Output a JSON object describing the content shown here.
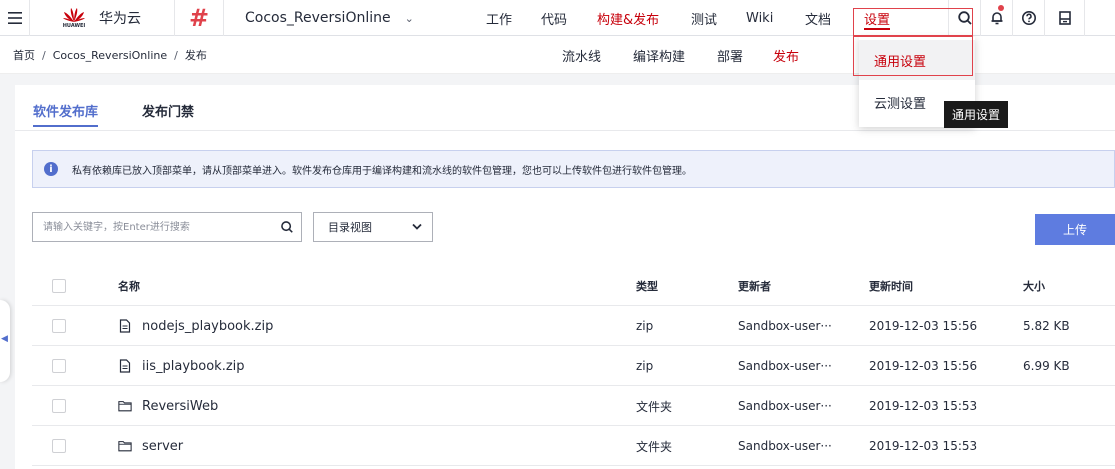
{
  "header": {
    "brand_name": "华为云",
    "brand_sub": "HUAWEI",
    "project_name": "Cocos_ReversiOnline",
    "nav": [
      {
        "label": "工作"
      },
      {
        "label": "代码"
      },
      {
        "label": "构建&发布",
        "active": true
      },
      {
        "label": "测试"
      },
      {
        "label": "Wiki"
      },
      {
        "label": "文档"
      },
      {
        "label": "设置"
      }
    ]
  },
  "breadcrumb": [
    "首页",
    "/",
    "Cocos_ReversiOnline",
    "/",
    "发布"
  ],
  "subnav": [
    {
      "label": "流水线"
    },
    {
      "label": "编译构建"
    },
    {
      "label": "部署"
    },
    {
      "label": "发布",
      "active": true
    }
  ],
  "tabs": [
    {
      "label": "软件发布库",
      "active": true
    },
    {
      "label": "发布门禁"
    }
  ],
  "notice": "私有依赖库已放入顶部菜单，请从顶部菜单进入。软件发布仓库用于编译构建和流水线的软件包管理，您也可以上传软件包进行软件包管理。",
  "search": {
    "placeholder": "请输入关键字，按Enter进行搜索",
    "value": ""
  },
  "view_select": "目录视图",
  "upload_label": "上传",
  "table": {
    "headers": [
      "名称",
      "类型",
      "更新者",
      "更新时间",
      "大小"
    ],
    "rows": [
      {
        "icon": "file-icon",
        "name": "nodejs_playbook.zip",
        "type": "zip",
        "updater": "Sandbox-user···",
        "time": "2019-12-03 15:56",
        "size": "5.82 KB"
      },
      {
        "icon": "file-icon",
        "name": "iis_playbook.zip",
        "type": "zip",
        "updater": "Sandbox-user···",
        "time": "2019-12-03 15:56",
        "size": "6.99 KB"
      },
      {
        "icon": "folder-icon",
        "name": "ReversiWeb",
        "type": "文件夹",
        "updater": "Sandbox-user···",
        "time": "2019-12-03 15:53",
        "size": ""
      },
      {
        "icon": "folder-icon",
        "name": "server",
        "type": "文件夹",
        "updater": "Sandbox-user···",
        "time": "2019-12-03 15:53",
        "size": ""
      }
    ]
  },
  "settings_dropdown": {
    "items": [
      {
        "label": "通用设置",
        "selected": true
      },
      {
        "label": "云测设置"
      }
    ]
  },
  "tooltip": "通用设置",
  "colors": {
    "brand_red": "#c7000b",
    "accent_blue": "#526ecc",
    "button_blue": "#5e7ce0"
  }
}
